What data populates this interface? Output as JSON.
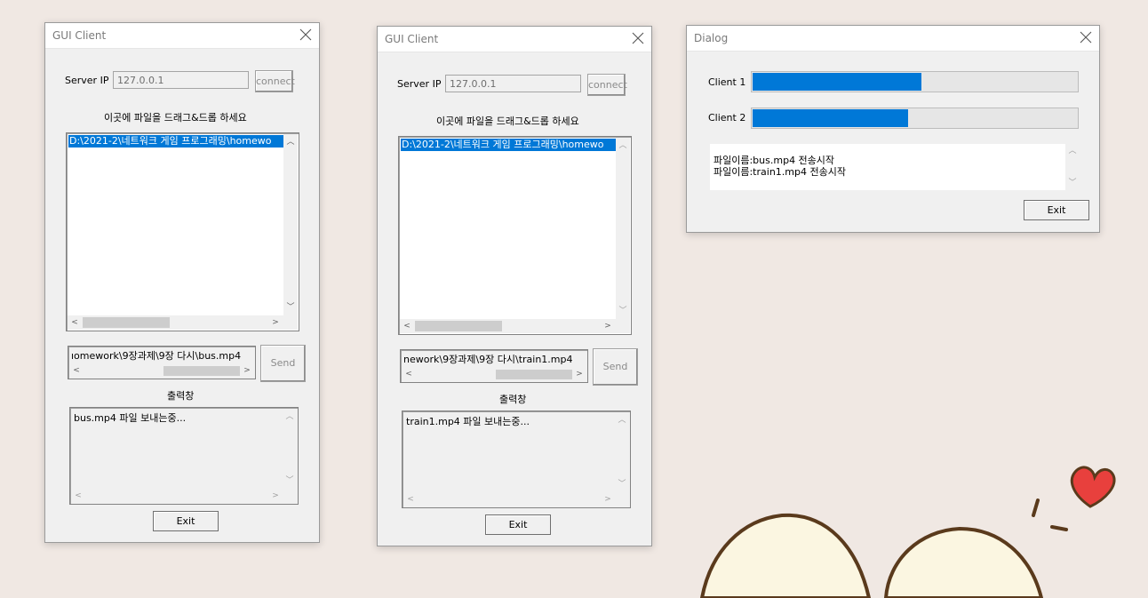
{
  "window1": {
    "title": "GUI Client",
    "server_ip_label": "Server IP",
    "server_ip_value": "127.0.0.1",
    "connect_label": "connect",
    "drop_hint": "이곳에 파일을 드래그&드롭 하세요",
    "file_list": [
      "D:\\2021-2\\네트워크 게임 프로그래밍\\homewo"
    ],
    "path_field": "ıomework\\9장과제\\9장 다시\\bus.mp4",
    "send_label": "Send",
    "output_label": "출력창",
    "output_text": "bus.mp4 파일 보내는중...",
    "exit_label": "Exit"
  },
  "window2": {
    "title": "GUI Client",
    "server_ip_label": "Server IP",
    "server_ip_value": "127.0.0.1",
    "connect_label": "connect",
    "drop_hint": "이곳에 파일을 드래그&드롭 하세요",
    "file_list": [
      "D:\\2021-2\\네트워크 게임 프로그래밍\\homewo"
    ],
    "path_field": "nework\\9장과제\\9장 다시\\train1.mp4",
    "send_label": "Send",
    "output_label": "출력창",
    "output_text": "train1.mp4 파일 보내는중...",
    "exit_label": "Exit"
  },
  "dialog": {
    "title": "Dialog",
    "client1_label": "Client 1",
    "client1_progress": 0.52,
    "client2_label": "Client 2",
    "client2_progress": 0.48,
    "log_lines": [
      "파일이름:bus.mp4 전송시작",
      "파일이름:train1.mp4 전송시작"
    ],
    "exit_label": "Exit"
  },
  "colors": {
    "accent": "#0078d7",
    "background": "#f0e8e3",
    "heart": "#e8403d",
    "bun": "#fbf6e1",
    "outline": "#5a3a1c"
  },
  "icons": [
    "close-icon",
    "scroll-up-arrow-icon",
    "scroll-down-arrow-icon",
    "scroll-left-arrow-icon",
    "scroll-right-arrow-icon",
    "heart-icon"
  ]
}
